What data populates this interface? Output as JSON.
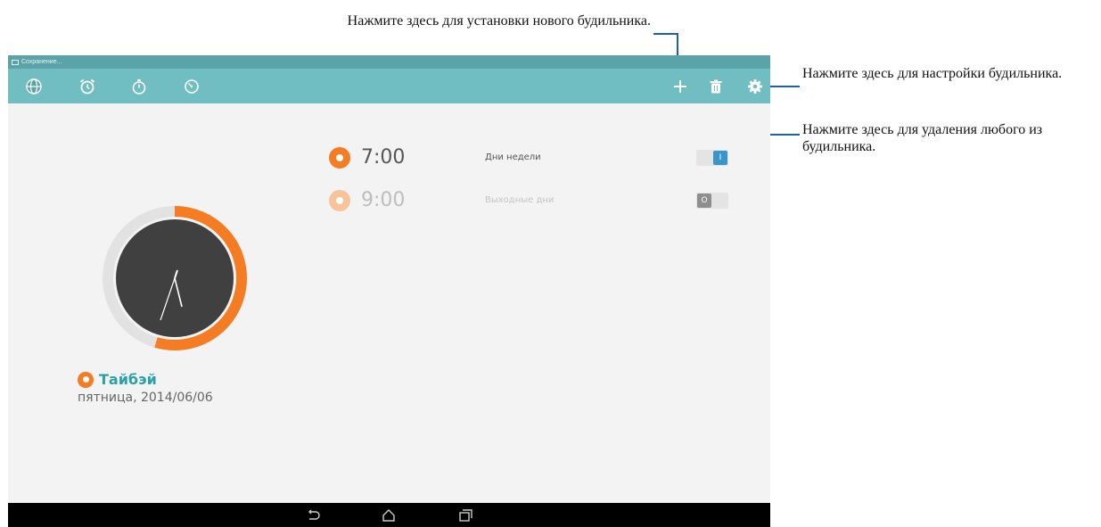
{
  "annotations": {
    "add_alarm": "Нажмите здесь для установки нового будильника.",
    "settings": "Нажмите здесь для настройки будильника.",
    "delete": "Нажмите здесь для удаления любого из будильника."
  },
  "status_bar": {
    "text": "Сохранение..."
  },
  "app_bar": {
    "tabs": [
      {
        "icon": "globe-icon"
      },
      {
        "icon": "alarm-clock-icon"
      },
      {
        "icon": "stopwatch-icon"
      },
      {
        "icon": "timer-icon"
      }
    ],
    "actions": [
      {
        "icon": "plus-icon"
      },
      {
        "icon": "trash-icon"
      },
      {
        "icon": "gear-icon"
      }
    ]
  },
  "alarms": [
    {
      "time": "7:00",
      "repeat": "Дни недели",
      "enabled": true,
      "toggle_label": "I"
    },
    {
      "time": "9:00",
      "repeat": "Выходные дни",
      "enabled": false,
      "toggle_label": "O"
    }
  ],
  "world_clock": {
    "city": "Тайбэй",
    "date": "пятница, 2014/06/06"
  },
  "navigation": [
    {
      "icon": "back-icon"
    },
    {
      "icon": "home-icon"
    },
    {
      "icon": "recent-apps-icon"
    }
  ],
  "colors": {
    "app_bar": "#71bec2",
    "status_bar": "#5ba3a8",
    "accent_orange": "#f57c22",
    "accent_teal": "#2aa1a6",
    "toggle_on": "#3a95c9",
    "toggle_off": "#8e8e8e"
  }
}
